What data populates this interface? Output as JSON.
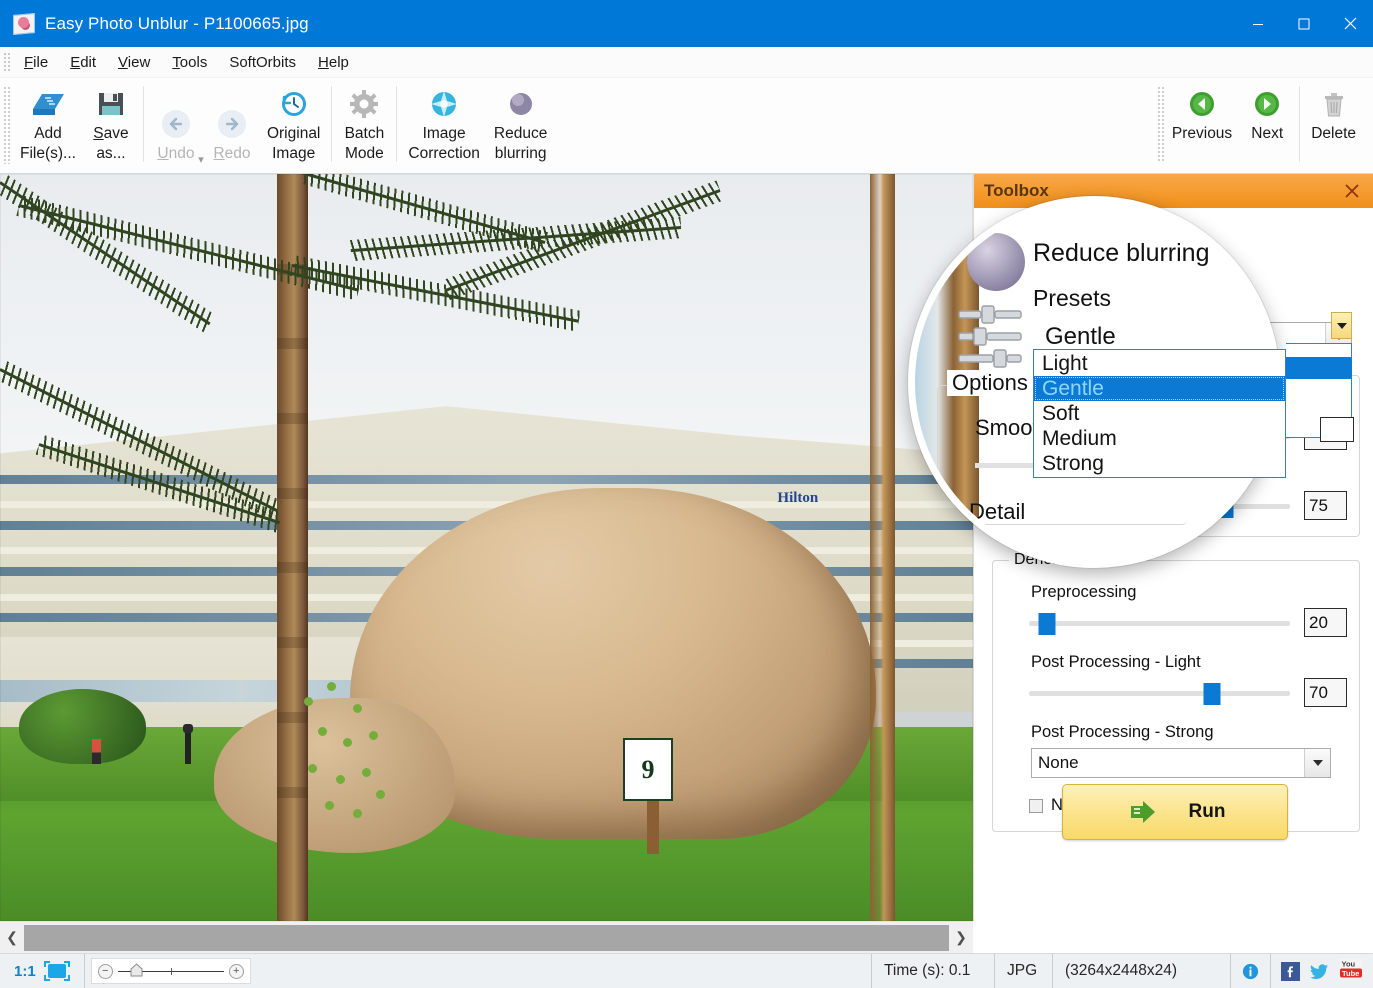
{
  "window": {
    "title": "Easy Photo Unblur - P1100665.jpg",
    "app_icon": "photo-rose-icon",
    "minimize": "minimize-icon",
    "maximize": "maximize-icon",
    "close": "close-icon",
    "accent_color": "#0078d7"
  },
  "menubar": {
    "items": [
      {
        "label": "File",
        "mnemonic": "F"
      },
      {
        "label": "Edit",
        "mnemonic": "E"
      },
      {
        "label": "View",
        "mnemonic": "V"
      },
      {
        "label": "Tools",
        "mnemonic": "T"
      },
      {
        "label": "SoftOrbits",
        "mnemonic": ""
      },
      {
        "label": "Help",
        "mnemonic": "H"
      }
    ]
  },
  "ribbon": {
    "buttons": [
      {
        "name": "add-files",
        "line1": "Add",
        "line2": "File(s)...",
        "icon": "add-files-icon",
        "enabled": true
      },
      {
        "name": "save-as",
        "line1": "Save",
        "line2": "as...",
        "icon": "floppy-disk-icon",
        "enabled": true
      },
      {
        "name": "undo",
        "line1": "",
        "line2": "Undo",
        "icon": "undo-arrow-icon",
        "enabled": false
      },
      {
        "name": "redo",
        "line1": "",
        "line2": "Redo",
        "icon": "redo-arrow-icon",
        "enabled": false
      },
      {
        "name": "original-image",
        "line1": "Original",
        "line2": "Image",
        "icon": "clock-history-icon",
        "enabled": true
      },
      {
        "name": "batch-mode",
        "line1": "Batch",
        "line2": "Mode",
        "icon": "gear-icon",
        "enabled": true
      },
      {
        "name": "image-correction",
        "line1": "Image",
        "line2": "Correction",
        "icon": "star-burst-icon",
        "enabled": true
      },
      {
        "name": "reduce-blurring",
        "line1": "Reduce",
        "line2": "blurring",
        "icon": "purple-orb-icon",
        "enabled": true
      }
    ],
    "nav": [
      {
        "name": "previous",
        "label": "Previous",
        "icon": "green-left-arrow-icon"
      },
      {
        "name": "next",
        "label": "Next",
        "icon": "green-right-arrow-icon"
      },
      {
        "name": "delete",
        "label": "Delete",
        "icon": "trash-icon"
      }
    ],
    "expand_glyph": "▾"
  },
  "photo": {
    "subject": "Hilton hotel building with palm tree and large rock",
    "hotel_sign": "Hilton",
    "marker_number": "9"
  },
  "canvas_scroll": {
    "left_arrow": "chevron-left-icon",
    "right_arrow": "chevron-right-icon"
  },
  "toolbox": {
    "title": "Toolbox",
    "close": "close-icon",
    "section": {
      "heading": "Reduce blurring",
      "icon": "purple-orb-icon",
      "presets_label": "Presets",
      "presets_value": "Gentle",
      "presets_options": [
        "Light",
        "Gentle",
        "Soft",
        "Medium",
        "Strong"
      ],
      "presets_selected_index": 1,
      "options_group_label": "Options",
      "sliders": [
        {
          "name": "smooth",
          "label": "Smooth",
          "value": "",
          "percent": 22
        },
        {
          "name": "detail",
          "label": "Detail",
          "value": "75",
          "percent": 75
        }
      ]
    },
    "denoise": {
      "group_label": "Denoise",
      "preprocessing": {
        "label": "Preprocessing",
        "value": "20",
        "percent": 7
      },
      "post_light": {
        "label": "Post Processing - Light",
        "value": "70",
        "percent": 70
      },
      "post_strong": {
        "label": "Post Processing - Strong",
        "value": "None"
      },
      "normalize": {
        "label": "Normalize Histogram",
        "checked": false
      }
    },
    "run_button": {
      "label": "Run",
      "icon": "green-double-arrow-icon"
    }
  },
  "statusbar": {
    "zoom_ratio": "1:1",
    "fit_icon": "fit-to-window-icon",
    "zoom_minus": "minus-icon",
    "zoom_plus": "plus-icon",
    "zoom_home": "home-marker-icon",
    "time": "Time (s): 0.1",
    "format": "JPG",
    "dimensions": "(3264x2448x24)",
    "icons": [
      {
        "name": "info-icon",
        "label": "i"
      },
      {
        "name": "facebook-icon",
        "label": "f"
      },
      {
        "name": "twitter-icon",
        "label": "t"
      },
      {
        "name": "youtube-icon",
        "label": "You Tube"
      }
    ]
  }
}
